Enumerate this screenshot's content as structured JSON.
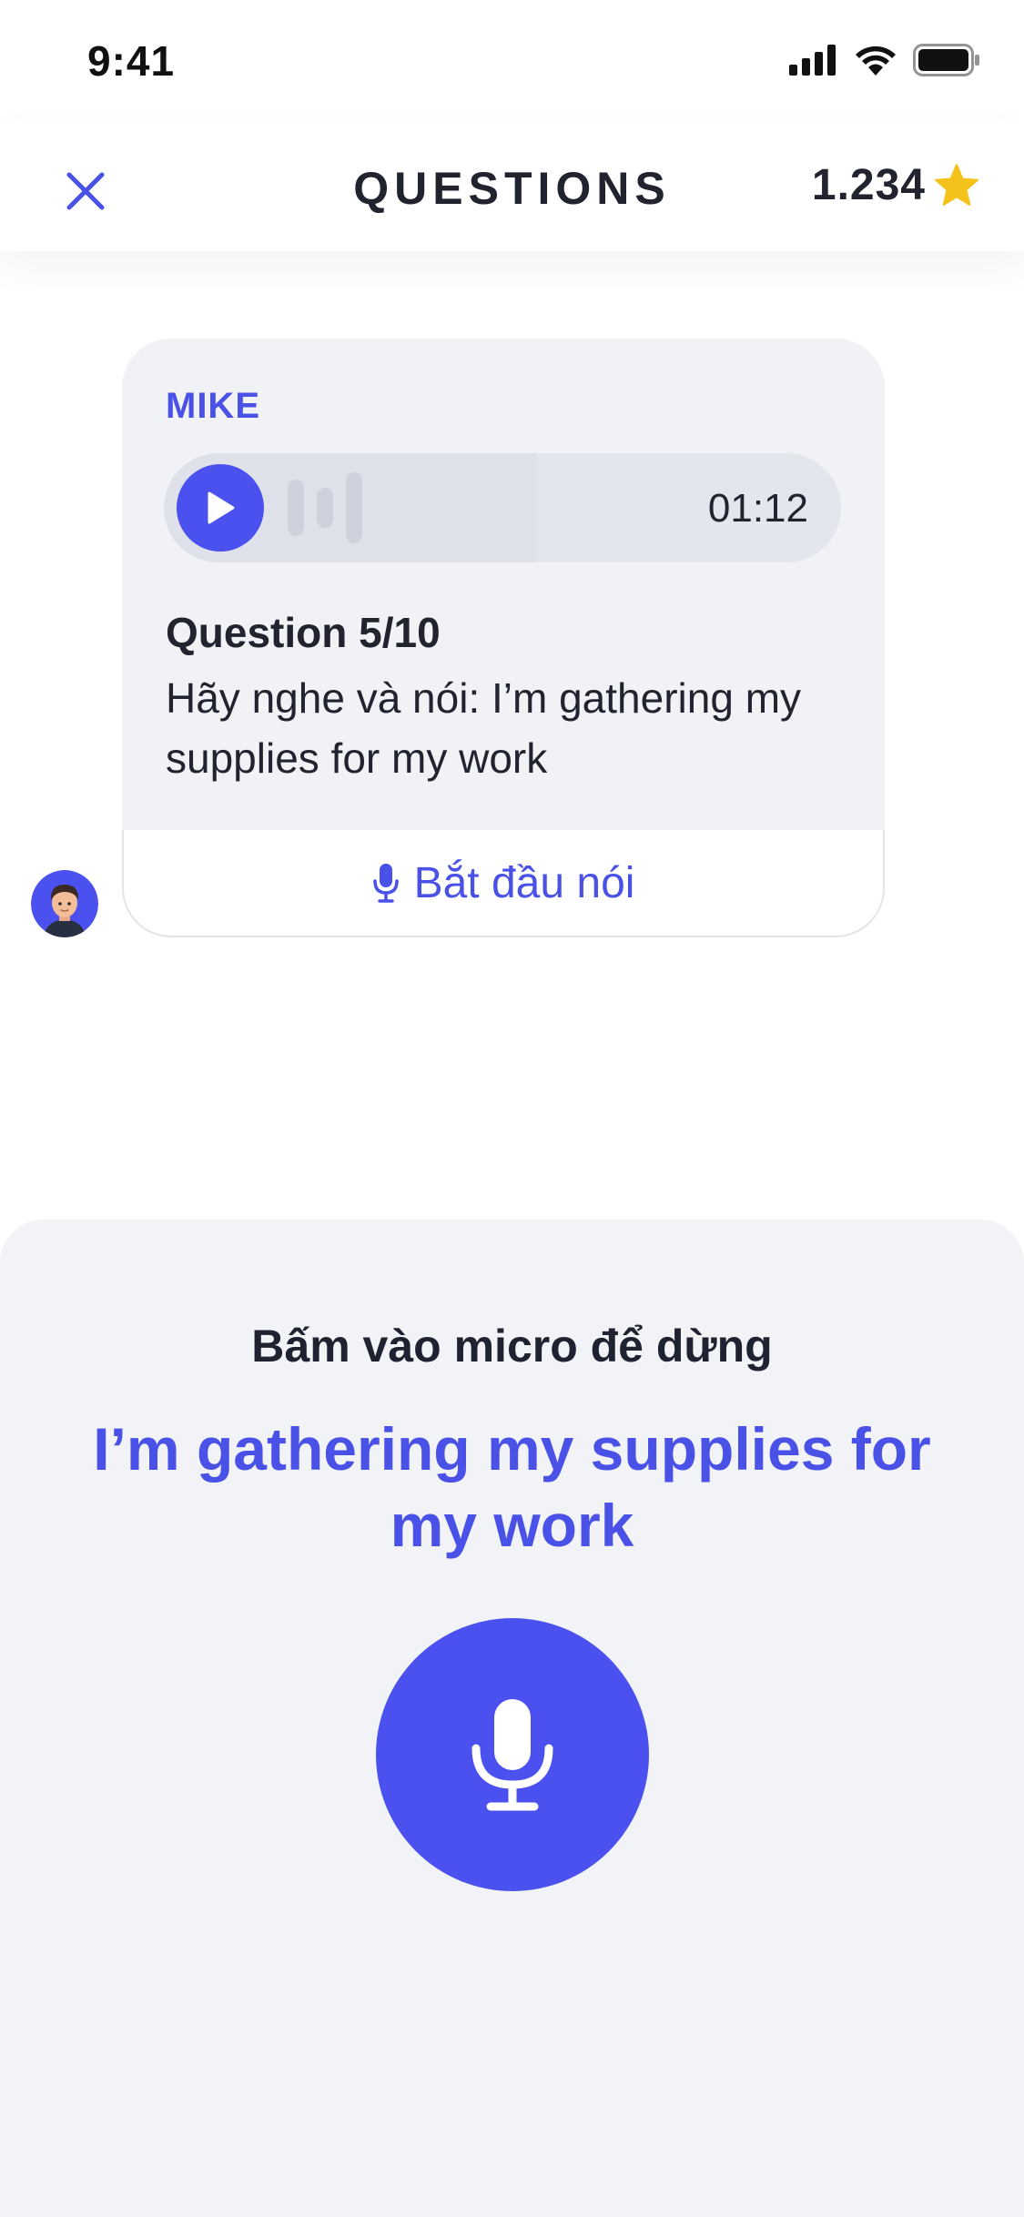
{
  "status_bar": {
    "time": "9:41"
  },
  "nav": {
    "title": "QUESTIONS",
    "score": "1.234"
  },
  "message": {
    "sender": "MIKE",
    "audio": {
      "duration": "01:12",
      "progress": 0.55
    },
    "question_label": "Question 5/10",
    "question_text": "Hãy nghe và nói: I’m gathering my supplies for my work",
    "speak_button_label": "Bắt đầu nói"
  },
  "recording": {
    "hint": "Bấm vào micro để dừng",
    "spoken_text": "I’m gathering my supplies for my work"
  },
  "colors": {
    "accent": "#4a51ee",
    "star": "#f5c21b",
    "sheet": "#f2f3f7"
  },
  "icons": [
    "close-icon",
    "star-icon",
    "play-icon",
    "microphone-icon",
    "avatar-mike"
  ]
}
